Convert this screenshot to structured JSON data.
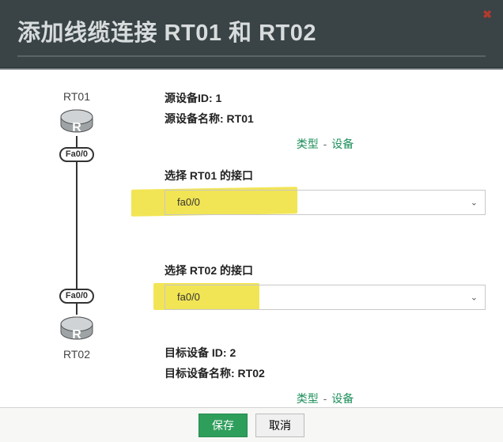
{
  "header": {
    "title": "添加线缆连接 RT01 和 RT02"
  },
  "diagram": {
    "src_label": "RT01",
    "src_port": "Fa0/0",
    "dst_port": "Fa0/0",
    "dst_label": "RT02"
  },
  "source": {
    "id_label": "源设备ID: 1",
    "name_label": "源设备名称: RT01",
    "type_link": "类型",
    "device_link": "设备",
    "select_label": "选择 RT01 的接口",
    "select_value": "fa0/0"
  },
  "target": {
    "select_label": "选择 RT02 的接口",
    "select_value": "fa0/0",
    "id_label": "目标设备 ID: 2",
    "name_label": "目标设备名称: RT02",
    "type_link": "类型",
    "device_link": "设备"
  },
  "footer": {
    "save": "保存",
    "cancel": "取消"
  }
}
